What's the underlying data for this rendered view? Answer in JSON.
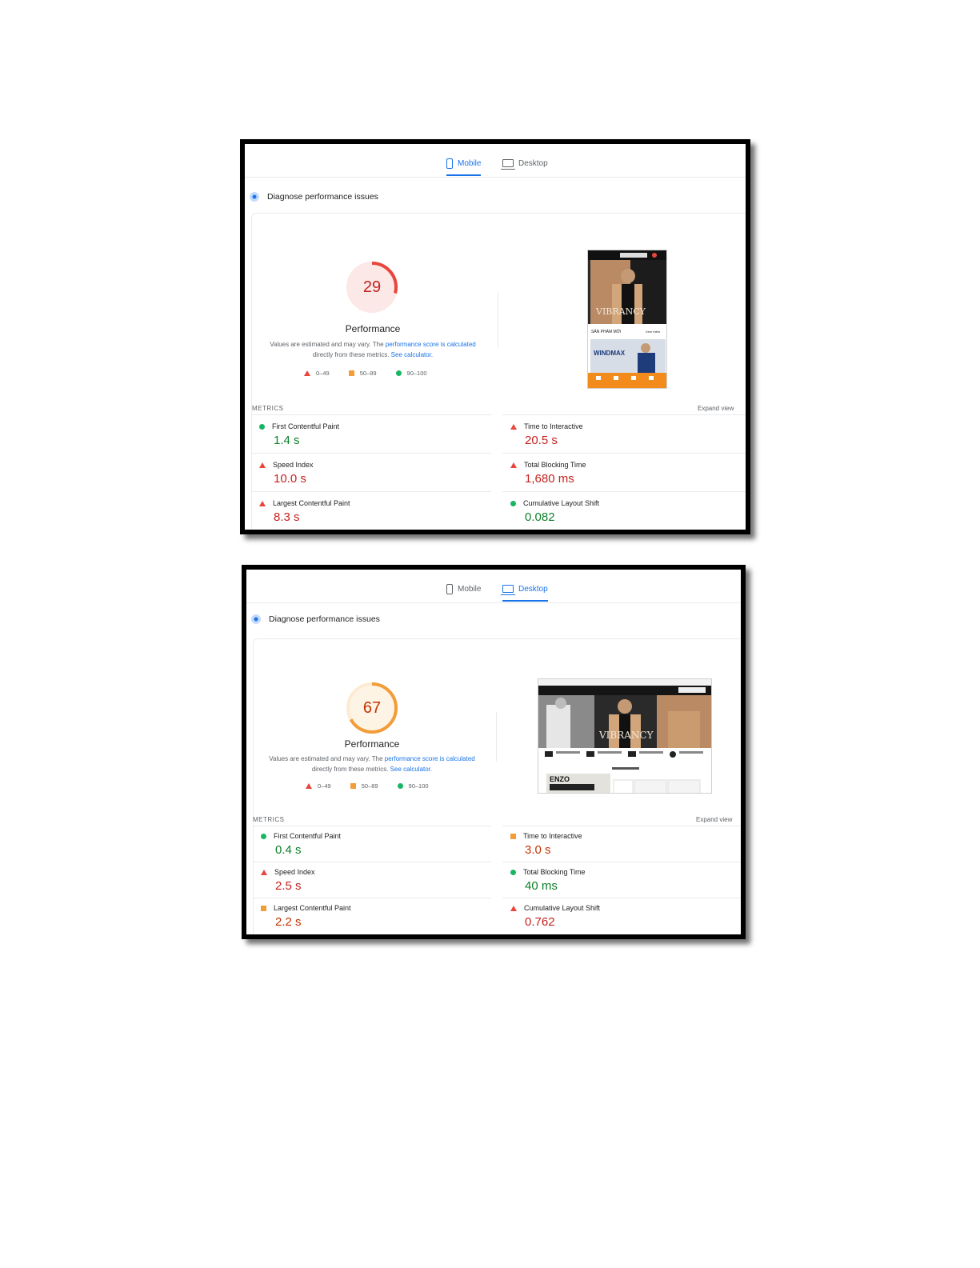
{
  "colors": {
    "accent": "#1a73e8",
    "fail": "#e8453c",
    "average": "#f29d38",
    "pass": "#18b663"
  },
  "mobile": {
    "tabs": {
      "mobile": "Mobile",
      "desktop": "Desktop",
      "active": "mobile"
    },
    "diagnose": "Diagnose performance issues",
    "score": 29,
    "score_fraction": 0.29,
    "performance_label": "Performance",
    "desc_prefix": "Values are estimated and may vary. The",
    "desc_link1": "performance score is calculated",
    "desc_middle": "directly from these metrics.",
    "desc_link2": "See calculator.",
    "legend": [
      "0–49",
      "50–89",
      "90–100"
    ],
    "metrics_label": "METRICS",
    "expand_view": "Expand view",
    "metrics": [
      {
        "label": "First Contentful Paint",
        "value": "1.4 s",
        "status": "pass"
      },
      {
        "label": "Time to Interactive",
        "value": "20.5 s",
        "status": "fail"
      },
      {
        "label": "Speed Index",
        "value": "10.0 s",
        "status": "fail"
      },
      {
        "label": "Total Blocking Time",
        "value": "1,680 ms",
        "status": "fail"
      },
      {
        "label": "Largest Contentful Paint",
        "value": "8.3 s",
        "status": "fail"
      },
      {
        "label": "Cumulative Layout Shift",
        "value": "0.082",
        "status": "pass"
      }
    ]
  },
  "desktop": {
    "tabs": {
      "mobile": "Mobile",
      "desktop": "Desktop",
      "active": "desktop"
    },
    "diagnose": "Diagnose performance issues",
    "score": 67,
    "score_fraction": 0.67,
    "performance_label": "Performance",
    "desc_prefix": "Values are estimated and may vary. The",
    "desc_link1": "performance score is calculated",
    "desc_middle": "directly from these metrics.",
    "desc_link2": "See calculator.",
    "legend": [
      "0–49",
      "50–89",
      "90–100"
    ],
    "metrics_label": "METRICS",
    "expand_view": "Expand view",
    "metrics": [
      {
        "label": "First Contentful Paint",
        "value": "0.4 s",
        "status": "pass"
      },
      {
        "label": "Time to Interactive",
        "value": "3.0 s",
        "status": "average"
      },
      {
        "label": "Speed Index",
        "value": "2.5 s",
        "status": "fail"
      },
      {
        "label": "Total Blocking Time",
        "value": "40 ms",
        "status": "pass"
      },
      {
        "label": "Largest Contentful Paint",
        "value": "2.2 s",
        "status": "average"
      },
      {
        "label": "Cumulative Layout Shift",
        "value": "0.762",
        "status": "fail"
      }
    ]
  }
}
